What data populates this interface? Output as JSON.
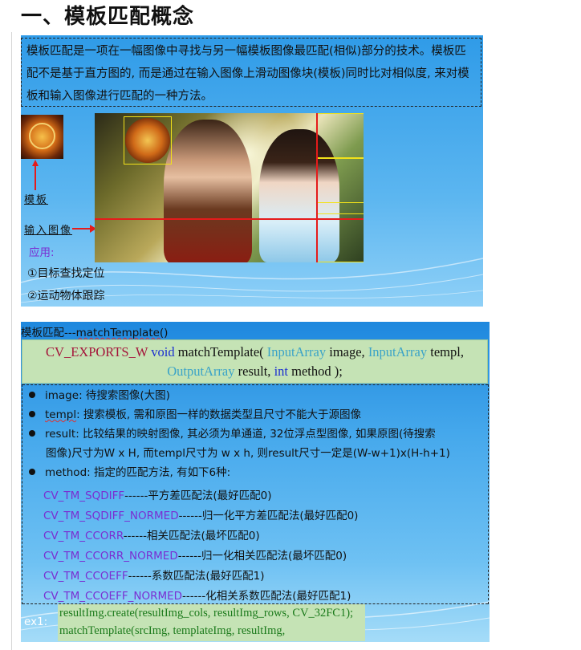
{
  "title": "一、模板匹配概念",
  "slide1": {
    "intro": "模板匹配是一项在一幅图像中寻找与另一幅模板图像最匹配(相似)部分的技术。模板匹配不是基于直方图的, 而是通过在输入图像上滑动图像块(模板)同时比对相似度, 来对模板和输入图像进行匹配的一种方法。",
    "label_template": "模板",
    "label_input": "输入图像",
    "apply_heading": "应用:",
    "apply_items": [
      "①目标查找定位",
      "②运动物体跟踪"
    ]
  },
  "slide2": {
    "title_prefix": "模板匹配---",
    "title_fn": "matchTemplate()",
    "signature": {
      "exports": "CV_EXPORTS_W",
      "ret": "void",
      "name": "matchTemplate(",
      "t1": "InputArray",
      "p1": "image,",
      "t2": "InputArray",
      "p2": "templ,",
      "t3": "OutputArray",
      "p3": "result,",
      "t4": "int",
      "p4": "method );"
    },
    "params": [
      {
        "name": "image",
        "desc": ": 待搜索图像(大图)"
      },
      {
        "name": "templ",
        "desc": ": 搜索模板, 需和原图一样的数据类型且尺寸不能大于源图像"
      },
      {
        "name": "result",
        "desc": ": 比较结果的映射图像, 其必须为单通道, 32位浮点型图像, 如果原图(待搜索",
        "cont": "图像)尺寸为W x H, 而templ尺寸为 w x h, 则result尺寸一定是(W-w+1)x(H-h+1)"
      },
      {
        "name": "method",
        "desc": ": 指定的匹配方法, 有如下6种:"
      }
    ],
    "methods": [
      {
        "name": "CV_TM_SQDIFF",
        "desc": "------平方差匹配法(最好匹配0)"
      },
      {
        "name": "CV_TM_SQDIFF_NORMED",
        "desc": "------归一化平方差匹配法(最好匹配0)"
      },
      {
        "name": "CV_TM_CCORR",
        "desc": "------相关匹配法(最坏匹配0)"
      },
      {
        "name": "CV_TM_CCORR_NORMED",
        "desc": "------归一化相关匹配法(最坏匹配0)"
      },
      {
        "name": "CV_TM_CCOEFF",
        "desc": "------系数匹配法(最好匹配1)"
      },
      {
        "name": "CV_TM_CCOEFF_NORMED",
        "desc": "------化相关系数匹配法(最好匹配1)"
      }
    ],
    "example_label": "ex1:",
    "example_code": [
      "resultImg.create(resultImg_cols, resultImg_rows, CV_32FC1);",
      "matchTemplate(srcImg, templateImg, resultImg, CV_TM_SQDIFF);"
    ]
  },
  "colors": {
    "slide_blue": "#2f9be8",
    "code_bg": "#c5e3b5",
    "method_purple": "#7a2fd2",
    "keyword_blue": "#1a2fd0",
    "type_teal": "#3aa3c8",
    "marker_red": "#e51b1b",
    "box_yellow": "#f2e21a"
  }
}
